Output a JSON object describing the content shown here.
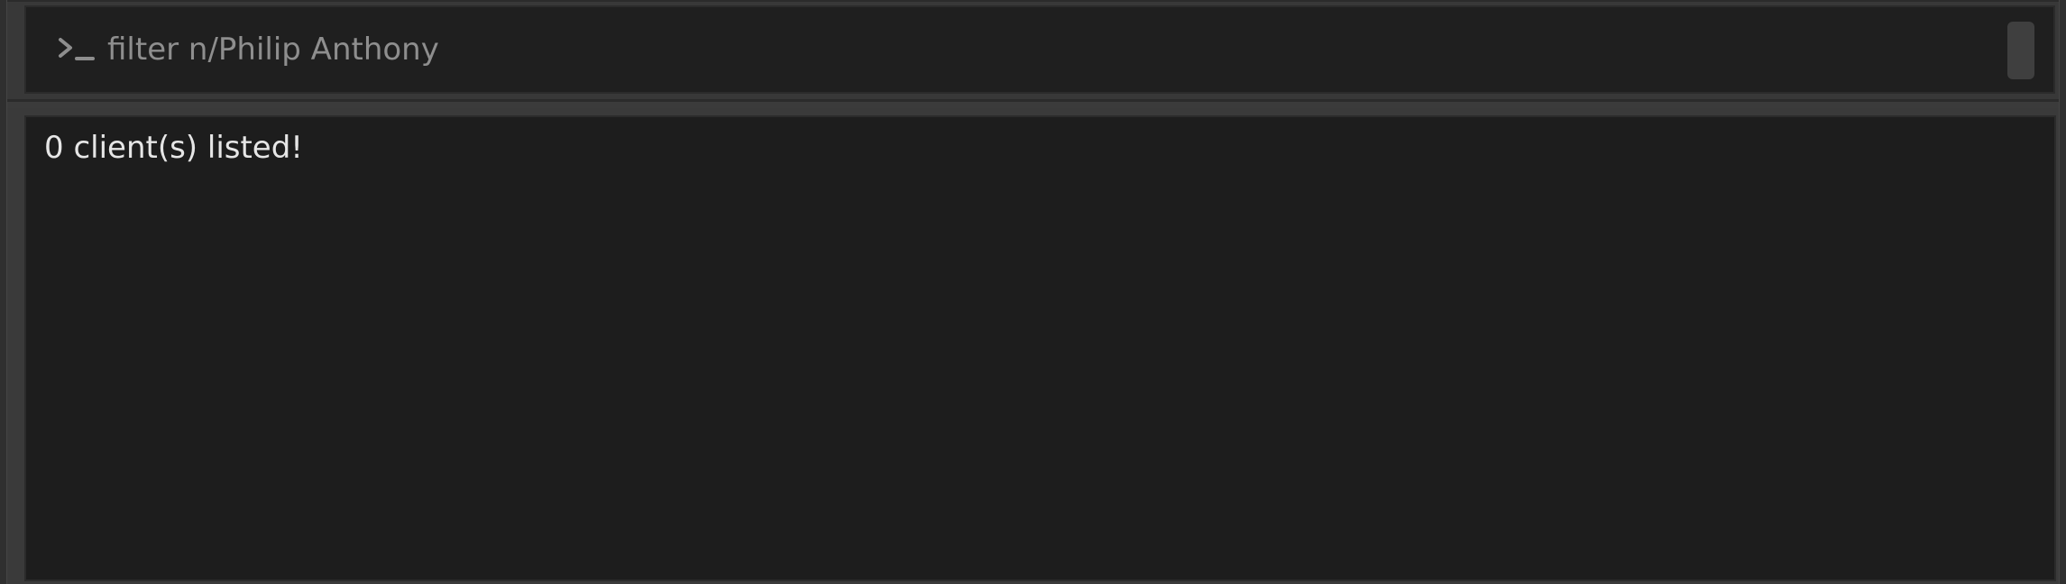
{
  "command_bar": {
    "icon": "terminal-prompt-icon",
    "text": "filter n/Philip Anthony"
  },
  "results": {
    "message": "0 client(s) listed!"
  },
  "colors": {
    "app_background": "#3b3b3b",
    "input_background": "#1f1f1f",
    "result_background": "#1d1d1d",
    "text": "#e6e6e6",
    "muted_text": "#8e8e8e"
  }
}
